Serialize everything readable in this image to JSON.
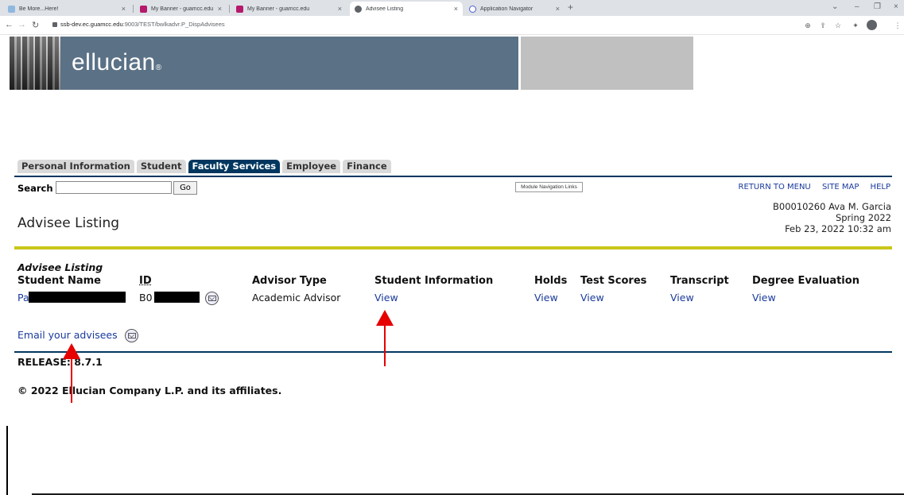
{
  "browser": {
    "tabs": [
      {
        "title": "Be More...Here!",
        "active": false
      },
      {
        "title": "My Banner - guamcc.edu",
        "active": false
      },
      {
        "title": "My Banner - guamcc.edu",
        "active": false
      },
      {
        "title": "Advisee Listing",
        "active": true
      },
      {
        "title": "Application Navigator",
        "active": false
      }
    ],
    "url_host": "ssb-dev.ec.guamcc.edu",
    "url_path": ":9003/TEST/bwlkadvr.P_DispAdvisees"
  },
  "banner": {
    "logo_text": "ellucian",
    "logo_mark": "®"
  },
  "nav_tabs": [
    "Personal Information",
    "Student",
    "Faculty Services",
    "Employee",
    "Finance"
  ],
  "active_tab": "Faculty Services",
  "search": {
    "label": "Search",
    "value": "",
    "go_label": "Go"
  },
  "module_nav_label": "Module Navigation Links",
  "top_links": [
    "RETURN TO MENU",
    "SITE MAP",
    "HELP"
  ],
  "page": {
    "title": "Advisee Listing",
    "user_line": "B00010260 Ava M. Garcia",
    "term": "Spring 2022",
    "datetime": "Feb 23, 2022 10:32 am"
  },
  "table": {
    "caption": "Advisee Listing",
    "headers": [
      "Student Name",
      "ID",
      "Advisor Type",
      "Student Information",
      "Holds",
      "Test Scores",
      "Transcript",
      "Degree Evaluation"
    ],
    "rows": [
      {
        "student_name_prefix": "Pa",
        "id_prefix": "B0",
        "advisor_type": "Academic Advisor",
        "student_information": "View",
        "holds": "View",
        "test_scores": "View",
        "transcript": "View",
        "degree_evaluation": "View"
      }
    ]
  },
  "email_link": "Email your advisees",
  "release": "RELEASE: 8.7.1",
  "copyright": "© 2022 Ellucian Company L.P. and its affiliates.",
  "colors": {
    "nav_active": "#01365f",
    "banner": "#5b7186",
    "divider_yellow": "#c9c61a",
    "link": "#1a3a9c",
    "annotation_arrow": "#e60000"
  }
}
